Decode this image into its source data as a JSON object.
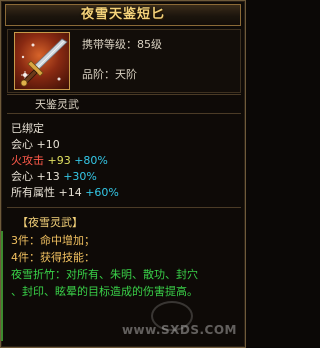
{
  "item": {
    "name": "夜雪天鉴短匕",
    "level_label": "携带等级：85级",
    "quality_label": "品阶：天阶",
    "section_title": "天鉴灵武"
  },
  "attributes": {
    "bound": "已绑定",
    "rows": [
      {
        "name": "会心",
        "value": "+10",
        "bonus": ""
      },
      {
        "name": "火攻击",
        "value": "+93",
        "bonus": "+80%"
      },
      {
        "name": "会心",
        "value": "+13",
        "bonus": "+30%"
      },
      {
        "name": "所有属性",
        "value": "+14",
        "bonus": "+60%"
      }
    ]
  },
  "set": {
    "title": "【夜雪灵武】",
    "line3": "3件：命中增加；",
    "line4": "4件：获得技能：",
    "skill_desc_1": "夜雪折竹：对所有、朱明、散功、封穴",
    "skill_desc_2": "、封印、眩晕的目标造成的伤害提高。"
  },
  "watermark": "www.SXDS.COM",
  "colors": {
    "title": "#f4d27a",
    "fire_attack": "#ff5a4a",
    "bonus": "#34c7e6",
    "set_desc": "#39d048"
  }
}
